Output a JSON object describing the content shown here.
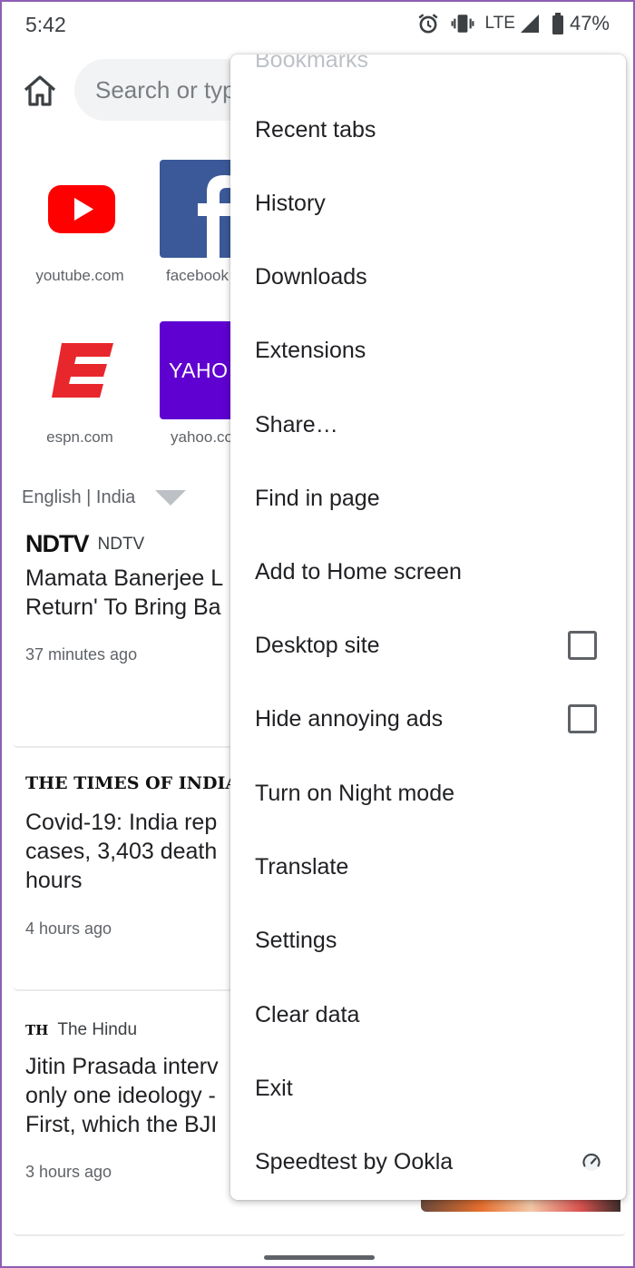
{
  "status": {
    "time": "5:42",
    "network": "LTE",
    "battery": "47%",
    "icons": [
      "alarm-icon",
      "vibrate-icon",
      "signal-icon",
      "battery-icon"
    ]
  },
  "toolbar": {
    "search_placeholder": "Search or typ"
  },
  "tiles": [
    {
      "label": "youtube.com",
      "icon": "youtube-icon",
      "color": "#ff0000"
    },
    {
      "label": "facebook",
      "icon": "facebook-icon",
      "color": "#3b5998"
    },
    {
      "label": "espn.com",
      "icon": "espn-icon",
      "color": "#e8272c"
    },
    {
      "label": "yahoo.co",
      "icon": "yahoo-icon",
      "color": "#5f01d1",
      "logo_text": "YAHO"
    }
  ],
  "feed": {
    "edition": "English | India",
    "articles": [
      {
        "source_logo": "NDTV",
        "source": "NDTV",
        "headline_lines": [
          "Mamata Banerjee L",
          "Return' To Bring Ba"
        ],
        "time": "37 minutes ago"
      },
      {
        "source_logo": "THE TIMES OF INDIA",
        "source": "T",
        "headline_lines": [
          "Covid-19: India rep",
          "cases, 3,403 death",
          "hours"
        ],
        "time": "4 hours ago"
      },
      {
        "source_logo": "TH",
        "source": "The Hindu",
        "headline_lines": [
          "Jitin Prasada interv",
          "only one ideology -",
          "First, which the BJI"
        ],
        "time": "3 hours ago"
      }
    ]
  },
  "menu": {
    "partial_top": "Bookmarks",
    "items": [
      {
        "label": "Recent tabs"
      },
      {
        "label": "History"
      },
      {
        "label": "Downloads"
      },
      {
        "label": "Extensions"
      },
      {
        "label": "Share…"
      },
      {
        "label": "Find in page"
      },
      {
        "label": "Add to Home screen"
      },
      {
        "label": "Desktop site",
        "control": "checkbox",
        "checked": false
      },
      {
        "label": "Hide annoying ads",
        "control": "checkbox",
        "checked": false
      },
      {
        "label": "Turn on Night mode"
      },
      {
        "label": "Translate"
      },
      {
        "label": "Settings"
      },
      {
        "label": "Clear data"
      },
      {
        "label": "Exit"
      },
      {
        "label": "Speedtest by Ookla",
        "icon": "speedometer-icon"
      }
    ]
  }
}
